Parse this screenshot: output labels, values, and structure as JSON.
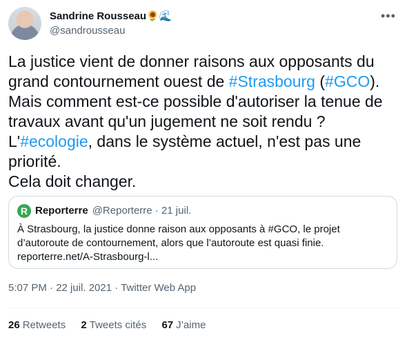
{
  "author": {
    "name": "Sandrine Rousseau🌻🌊",
    "handle": "@sandrousseau"
  },
  "more_label": "•••",
  "tweet": {
    "lines": [
      [
        "La justice vient de donner raisons aux opposants du",
        ""
      ],
      [
        "grand contournement ouest de ",
        "#Strasbourg",
        " (",
        "#GCO",
        ")."
      ],
      [
        "Mais comment est-ce possible d'autoriser la tenue de"
      ],
      [
        "travaux avant qu'un jugement ne soit rendu ?"
      ],
      [
        "L'",
        "#ecologie",
        ", dans le système actuel, n'est  pas une"
      ],
      [
        "priorité."
      ],
      [
        "Cela doit changer."
      ]
    ],
    "hashtag_strasbourg": "#Strasbourg",
    "hashtag_gco": "#GCO",
    "hashtag_ecologie": "#ecologie"
  },
  "quote": {
    "avatar_letter": "R",
    "name": "Reporterre",
    "meta": "@Reporterre · 21 juil.",
    "line1": "À Strasbourg, la justice donne raison aux opposants à #GCO, le projet",
    "line2": "d’autoroute de contournement, alors que l’autoroute est quasi finie.",
    "line3": "reporterre.net/A-Strasbourg-l..."
  },
  "timestamp": "5:07 PM · 22 juil. 2021 · Twitter Web App",
  "stats": {
    "retweets_count": "26",
    "retweets_label": "Retweets",
    "quotes_count": "2",
    "quotes_label": "Tweets cités",
    "likes_count": "67",
    "likes_label": "J’aime"
  },
  "colors": {
    "link": "#1d9bf0",
    "text": "#0f1419",
    "secondary": "#536471"
  }
}
